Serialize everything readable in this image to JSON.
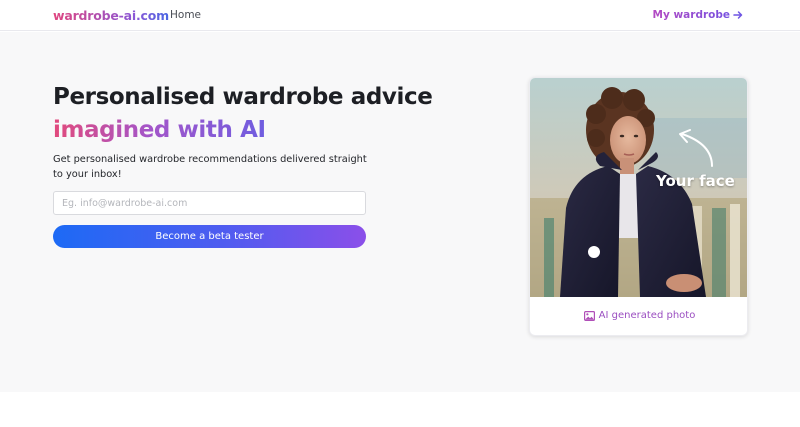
{
  "nav": {
    "logo": "wardrobe-ai.com",
    "home": "Home",
    "my_wardrobe": "My wardrobe"
  },
  "hero": {
    "title_line1": "Personalised wardrobe advice",
    "title_line2": "imagined with AI",
    "description": "Get personalised wardrobe recommendations delivered straight to your inbox!",
    "email_placeholder": "Eg. info@wardrobe-ai.com",
    "cta_label": "Become a beta tester"
  },
  "card": {
    "overlay_label": "Your face",
    "caption": "AI generated photo",
    "caption_icon": "image-icon"
  },
  "colors": {
    "brand_pink": "#e24a7c",
    "brand_purple": "#8b4fe9",
    "brand_blue": "#1d6af5",
    "hero_bg": "#f8f8f9"
  }
}
